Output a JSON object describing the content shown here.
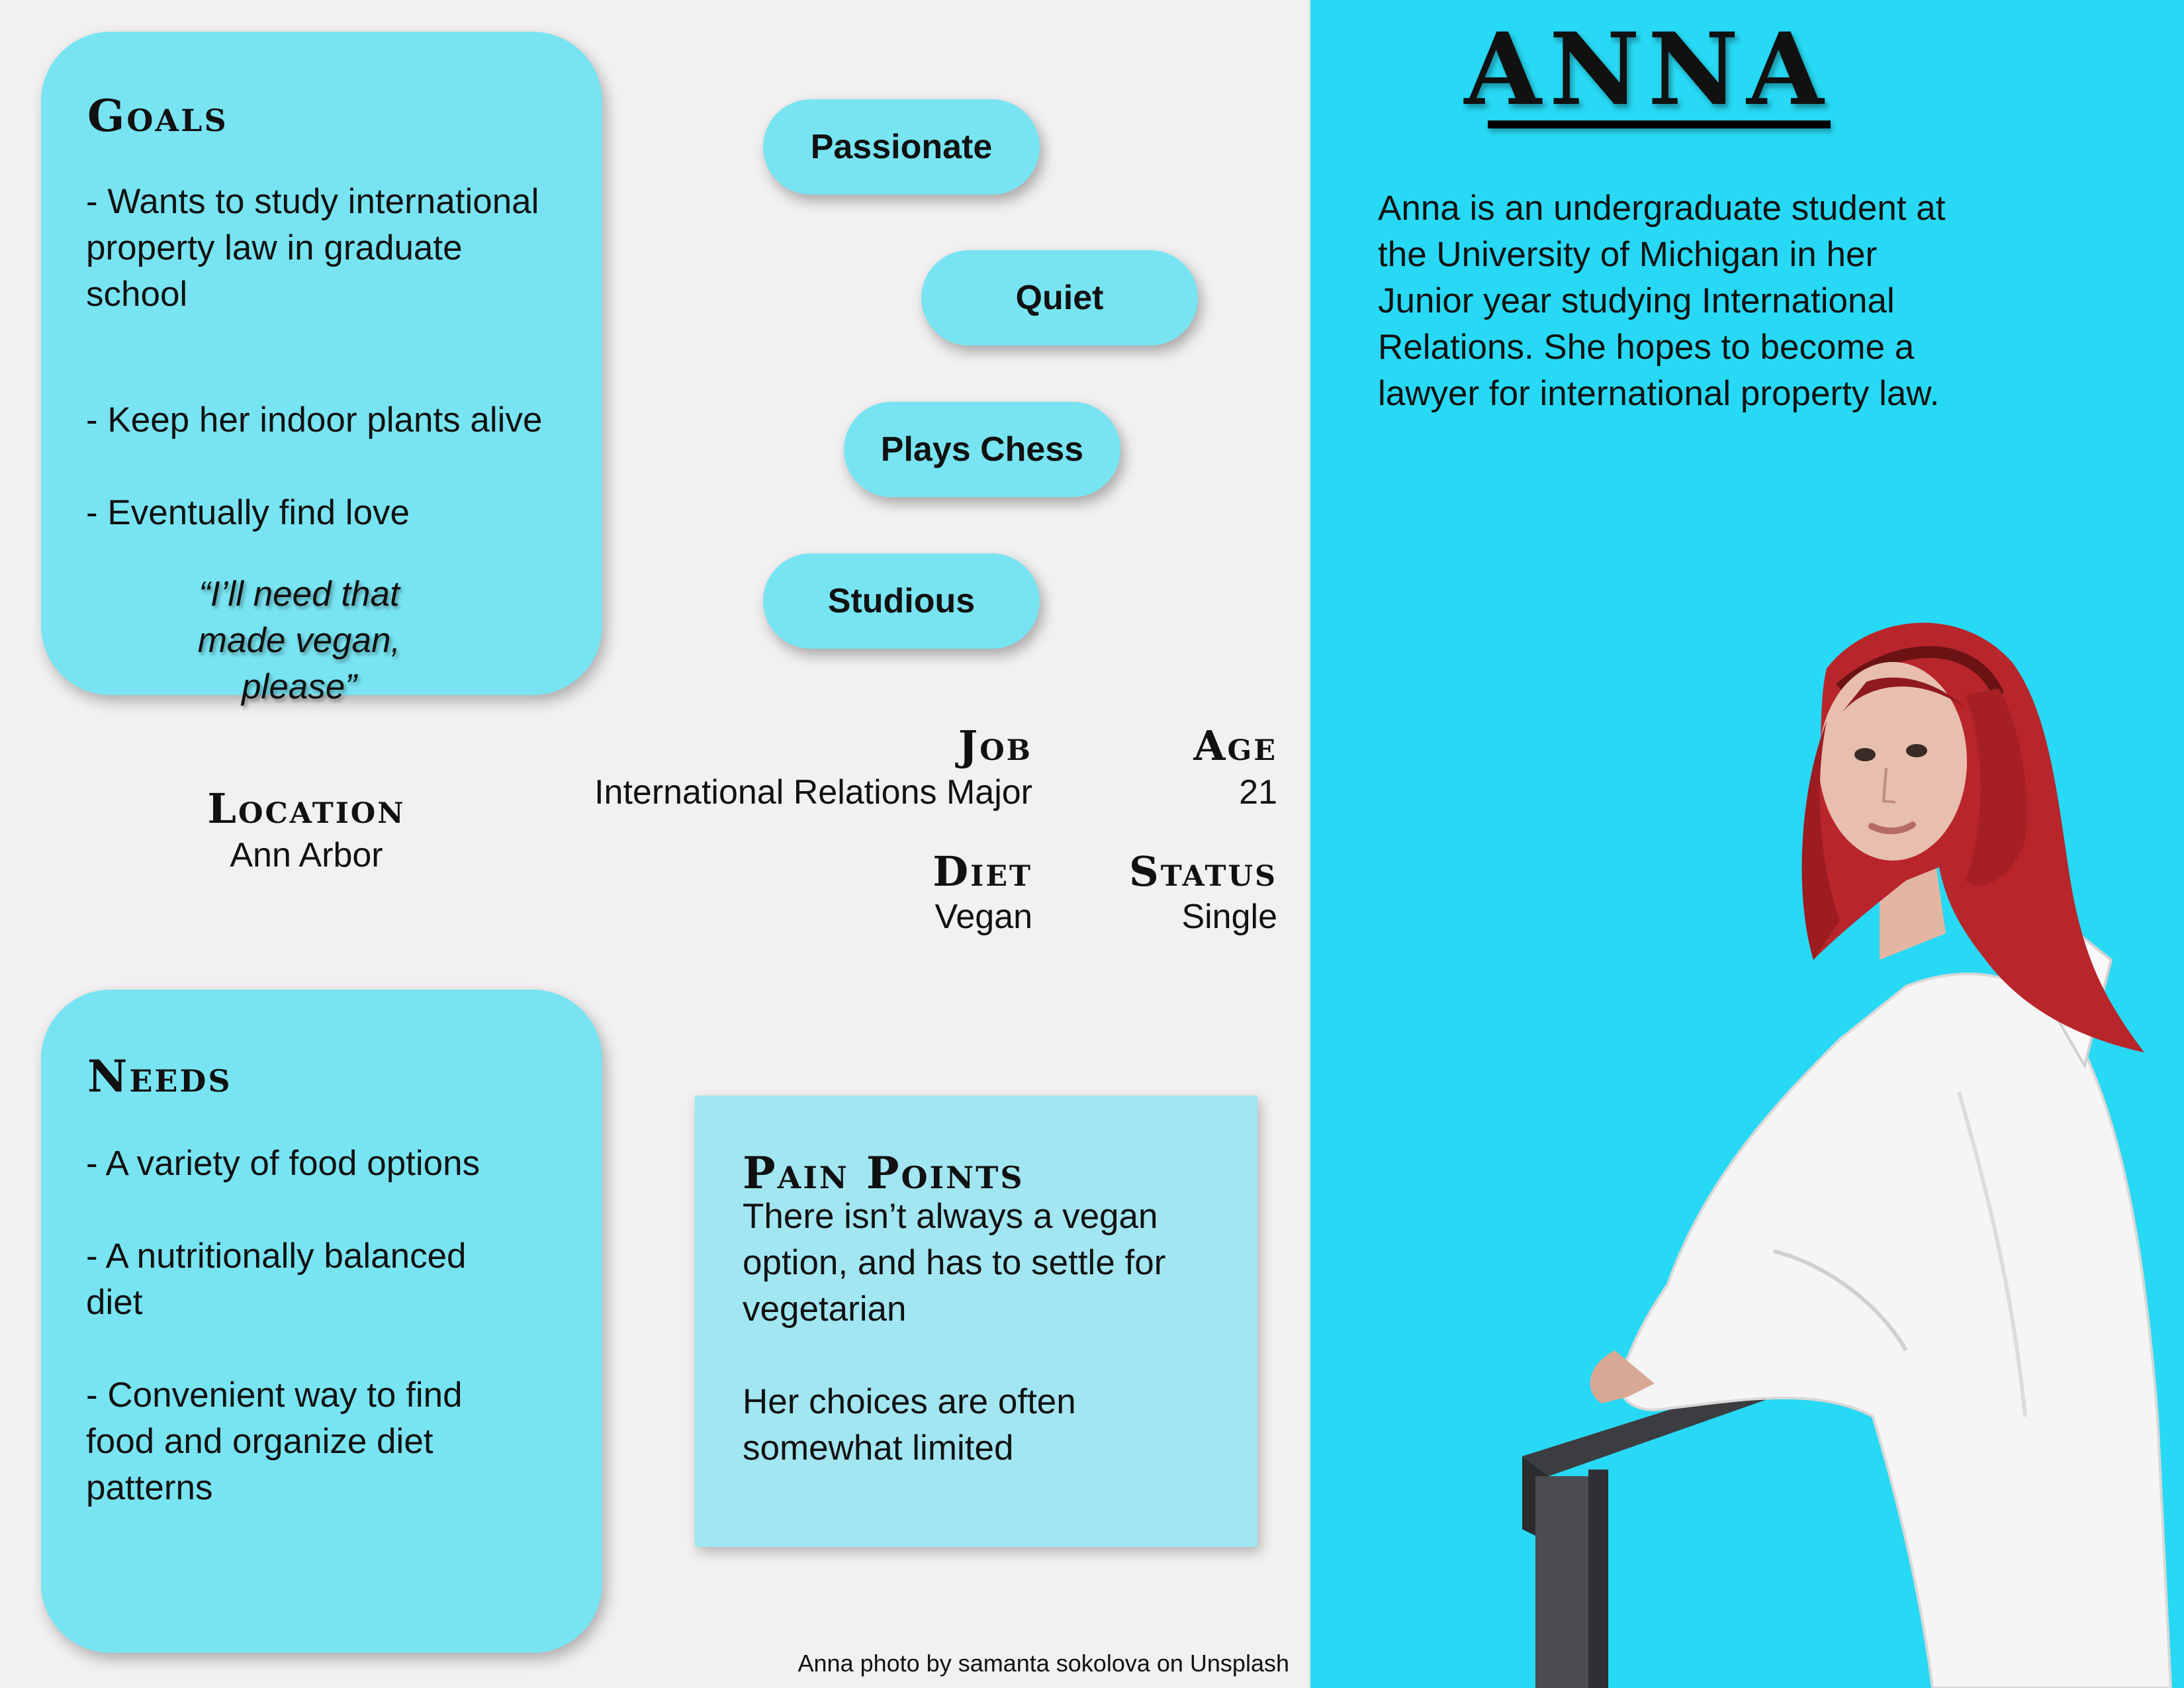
{
  "goals": {
    "title": "Goals",
    "items": [
      "- Wants to study international property law in graduate school",
      "- Keep her indoor plants alive",
      "- Eventually find love"
    ],
    "quote": "“I’ll need that made vegan, please”"
  },
  "traits": [
    "Passionate",
    "Quiet",
    "Plays Chess",
    "Studious"
  ],
  "info": {
    "location_label": "Location",
    "location_value": "Ann Arbor",
    "job_label": "Job",
    "job_value": "International Relations Major",
    "age_label": "Age",
    "age_value": "21",
    "diet_label": "Diet",
    "diet_value": "Vegan",
    "status_label": "Status",
    "status_value": "Single"
  },
  "needs": {
    "title": "Needs",
    "items": [
      "- A variety of food options",
      "- A nutritionally balanced diet",
      "- Convenient way to find food and organize diet patterns"
    ]
  },
  "pain_points": {
    "title": "Pain Points",
    "items": [
      "There isn’t always a vegan option, and has to settle for vegetarian",
      "Her choices are often somewhat limited"
    ]
  },
  "credit": "Anna photo by samanta sokolova on Unsplash",
  "persona": {
    "name": "ANNA",
    "bio": "Anna is an undergraduate student at the University of Michigan in her Junior year studying International Relations. She hopes to become a lawyer for international property law."
  },
  "colors": {
    "card": "#78e4f2",
    "panel": "#27d9f4",
    "page": "#f2f0f0",
    "hair": "#b8262c"
  }
}
